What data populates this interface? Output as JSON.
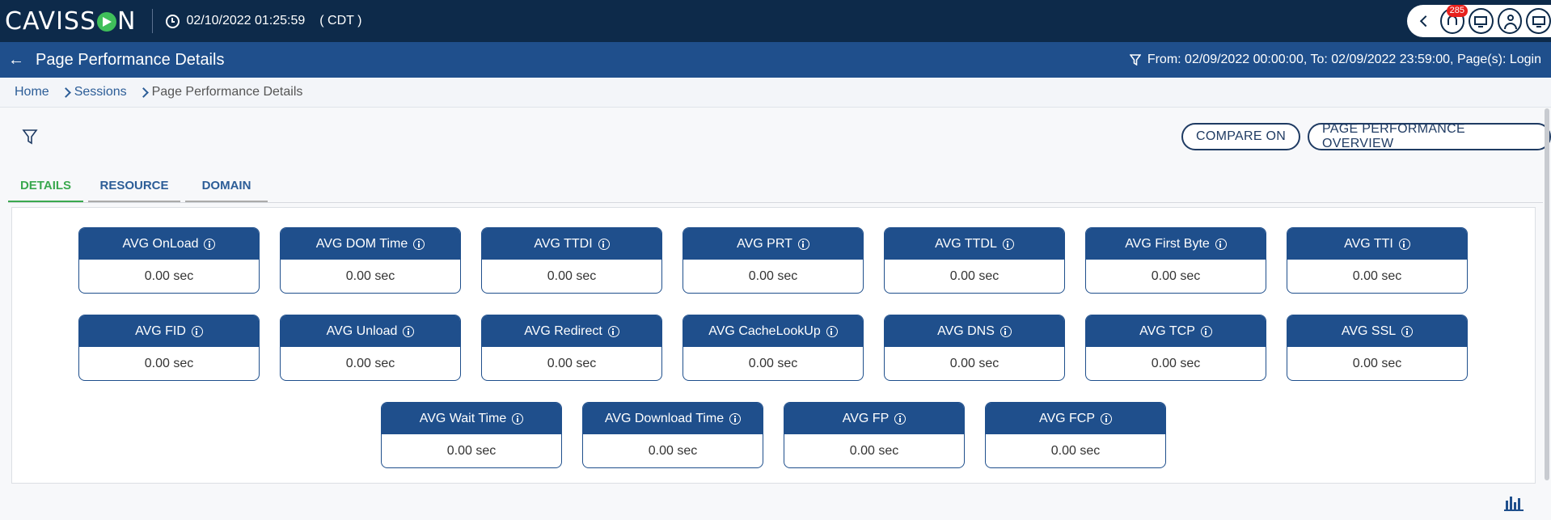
{
  "topbar": {
    "logo": "CAVISSON",
    "logo_pre": "CAVISS",
    "logo_post": "N",
    "datetime": "02/10/2022 01:25:59",
    "timezone": "( CDT )",
    "notification_count": "285",
    "icons": [
      "clock-icon",
      "chevron-left-icon",
      "bell-icon",
      "monitor-icon",
      "user-icon",
      "display-icon"
    ]
  },
  "titlebar": {
    "title": "Page Performance Details",
    "filter_text": "From: 02/09/2022 00:00:00, To: 02/09/2022 23:59:00, Page(s): Login"
  },
  "breadcrumb": [
    "Home",
    "Sessions",
    "Page Performance Details"
  ],
  "toolbar": {
    "compare_label": "COMPARE ON",
    "overview_label": "PAGE PERFORMANCE OVERVIEW"
  },
  "tabs": [
    {
      "label": "DETAILS",
      "active": true
    },
    {
      "label": "RESOURCE",
      "active": false
    },
    {
      "label": "DOMAIN",
      "active": false
    }
  ],
  "metrics": [
    {
      "label": "AVG OnLoad",
      "value": "0.00 sec"
    },
    {
      "label": "AVG DOM Time",
      "value": "0.00 sec"
    },
    {
      "label": "AVG TTDI",
      "value": "0.00 sec"
    },
    {
      "label": "AVG PRT",
      "value": "0.00 sec"
    },
    {
      "label": "AVG TTDL",
      "value": "0.00 sec"
    },
    {
      "label": "AVG First Byte",
      "value": "0.00 sec"
    },
    {
      "label": "AVG TTI",
      "value": "0.00 sec"
    },
    {
      "label": "AVG FID",
      "value": "0.00 sec"
    },
    {
      "label": "AVG Unload",
      "value": "0.00 sec"
    },
    {
      "label": "AVG Redirect",
      "value": "0.00 sec"
    },
    {
      "label": "AVG CacheLookUp",
      "value": "0.00 sec"
    },
    {
      "label": "AVG DNS",
      "value": "0.00 sec"
    },
    {
      "label": "AVG TCP",
      "value": "0.00 sec"
    },
    {
      "label": "AVG SSL",
      "value": "0.00 sec"
    },
    {
      "label": "AVG Wait Time",
      "value": "0.00 sec"
    },
    {
      "label": "AVG Download Time",
      "value": "0.00 sec"
    },
    {
      "label": "AVG FP",
      "value": "0.00 sec"
    },
    {
      "label": "AVG FCP",
      "value": "0.00 sec"
    }
  ],
  "colors": {
    "topbar": "#0d2a4a",
    "titlebar": "#1f4f8c",
    "card_header": "#1f4f8c",
    "active_tab": "#3aa84f",
    "badge": "#e8211d"
  }
}
